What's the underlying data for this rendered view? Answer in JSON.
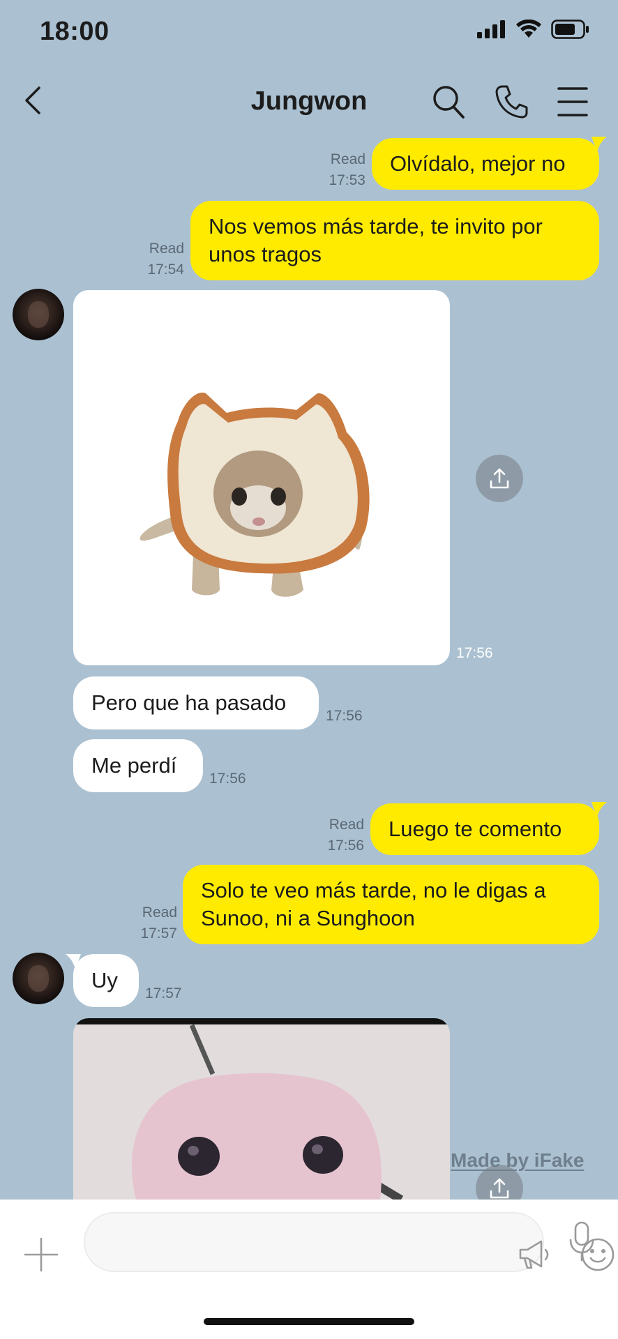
{
  "status_bar": {
    "time": "18:00"
  },
  "header": {
    "title": "Jungwon"
  },
  "messages": [
    {
      "text": "Olvídalo, mejor no",
      "read": "Read",
      "time": "17:53"
    },
    {
      "text": "Nos vemos más tarde, te invito por unos tragos",
      "read": "Read",
      "time": "17:54"
    },
    {
      "time": "17:56"
    },
    {
      "text": "Pero que ha pasado",
      "time": "17:56"
    },
    {
      "text": "Me perdí",
      "time": "17:56"
    },
    {
      "text": "Luego te comento",
      "read": "Read",
      "time": "17:56"
    },
    {
      "text": "Solo te veo más tarde, no le digas a Sunoo, ni a Sunghoon",
      "read": "Read",
      "time": "17:57"
    },
    {
      "text": "Uy",
      "time": "17:57"
    }
  ],
  "watermark": "Made by iFake",
  "colors": {
    "background": "#abc1d1",
    "outgoing_bubble": "#ffeb00",
    "incoming_bubble": "#ffffff"
  },
  "icons": [
    "back-arrow-icon",
    "search-icon",
    "phone-icon",
    "menu-icon",
    "share-icon",
    "plus-icon",
    "megaphone-icon",
    "emoji-icon",
    "microphone-icon"
  ]
}
